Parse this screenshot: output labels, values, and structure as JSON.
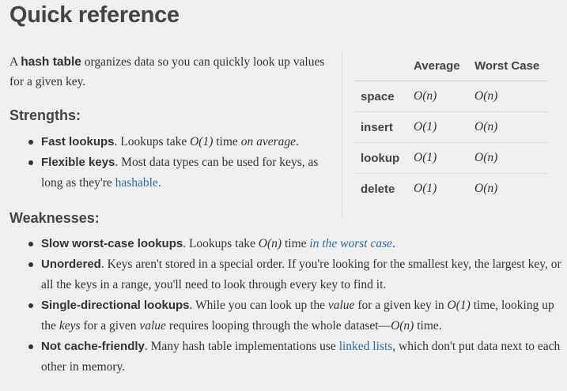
{
  "title": "Quick reference",
  "intro": {
    "prefix": "A ",
    "bold": "hash table",
    "suffix": " organizes data so you can quickly look up values for a given key."
  },
  "strengths": {
    "heading": "Strengths:",
    "items": [
      {
        "bold": "Fast lookups",
        "a": ". Lookups take ",
        "math": "O(1)",
        "b": " time ",
        "italic": "on average",
        "c": "."
      },
      {
        "bold": "Flexible keys",
        "a": ". Most data types can be used for keys, as long as they're ",
        "link": "hashable",
        "c": "."
      }
    ]
  },
  "weaknesses": {
    "heading": "Weaknesses:",
    "items": [
      {
        "bold": "Slow worst-case lookups",
        "a": ". Lookups take ",
        "math": "O(n)",
        "b": " time ",
        "link": "in the worst case",
        "c": "."
      },
      {
        "bold": "Unordered",
        "a": ". Keys aren't stored in a special order. If you're looking for the smallest key, the largest key, or all the keys in a range, you'll need to look through every key to find it."
      },
      {
        "bold": "Single-directional lookups",
        "a": ". While you can look up the ",
        "i1": "value",
        "b": " for a given key in ",
        "math1": "O(1)",
        "c": " time, looking up the ",
        "i2": "keys",
        "d": " for a given ",
        "i3": "value",
        "e": " requires looping through the whole dataset—",
        "math2": "O(n)",
        "f": " time."
      },
      {
        "bold": "Not cache-friendly",
        "a": ". Many hash table implementations use ",
        "link": "linked lists",
        "b": ", which don't put data next to each other in memory."
      }
    ]
  },
  "table": {
    "headers": [
      "",
      "Average",
      "Worst Case"
    ],
    "rows": [
      {
        "op": "space",
        "average": "O(n)",
        "worst": "O(n)"
      },
      {
        "op": "insert",
        "average": "O(1)",
        "worst": "O(n)"
      },
      {
        "op": "lookup",
        "average": "O(1)",
        "worst": "O(n)"
      },
      {
        "op": "delete",
        "average": "O(1)",
        "worst": "O(n)"
      }
    ]
  },
  "colors": {
    "background": "#efefef",
    "text": "#333333",
    "link": "#2e6b9e"
  }
}
